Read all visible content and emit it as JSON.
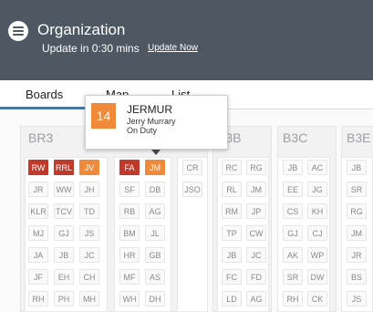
{
  "header": {
    "title": "Organization",
    "update_text": "Update in 0:30 mins",
    "update_link": "Update Now"
  },
  "tabs": [
    {
      "label": "Boards"
    },
    {
      "label": "Map"
    },
    {
      "label": "List"
    }
  ],
  "boards": [
    {
      "name": "BR3"
    },
    {
      "name": "B3B"
    },
    {
      "name": "B3C"
    },
    {
      "name": "B3E"
    }
  ],
  "columns": [
    {
      "cells": [
        [
          "RW",
          "RRL",
          "JV"
        ],
        [
          "JR",
          "WW",
          "JH"
        ],
        [
          "KLR",
          "TCV",
          "TD"
        ],
        [
          "MJ",
          "GJ",
          "JS"
        ],
        [
          "JA",
          "JB",
          "JC"
        ],
        [
          "JF",
          "EH",
          "CH"
        ],
        [
          "RH",
          "PH",
          "MH"
        ]
      ]
    },
    {
      "cells": [
        [
          "FA",
          "JM"
        ],
        [
          "SF",
          "DB"
        ],
        [
          "RB",
          "AG"
        ],
        [
          "BM",
          "JL"
        ],
        [
          "HR",
          "GB"
        ],
        [
          "MF",
          "AS"
        ],
        [
          "WH",
          "DH"
        ]
      ]
    },
    {
      "cells": [
        [
          "CR"
        ],
        [
          "JSO"
        ]
      ]
    },
    {
      "cells": [
        [
          "RC",
          "RG"
        ],
        [
          "RL",
          "JM"
        ],
        [
          "RM",
          "JP"
        ],
        [
          "TP",
          "CW"
        ],
        [
          "JB",
          "JC"
        ],
        [
          "FC",
          "FD"
        ],
        [
          "LD",
          "AG"
        ]
      ]
    },
    {
      "cells": [
        [
          "JB",
          "AC"
        ],
        [
          "EE",
          "JG"
        ],
        [
          "CS",
          "KH"
        ],
        [
          "GJ",
          "CJ"
        ],
        [
          "AK",
          "WP"
        ],
        [
          "SR",
          "DW"
        ],
        [
          "RH",
          "CK"
        ]
      ]
    },
    {
      "cells": [
        [
          "JB"
        ],
        [
          "SR"
        ],
        [
          "RG"
        ],
        [
          "JM"
        ],
        [
          "JR"
        ],
        [
          "BS"
        ],
        [
          "JS"
        ]
      ]
    }
  ],
  "highlight_colors": {
    "red": "#c0392b",
    "orange": "#f08a3a"
  },
  "tooltip": {
    "badge": "14",
    "code": "JERMUR",
    "name": "Jerry Murrary",
    "status": "On Duty"
  },
  "icons": {
    "menu": "hamburger-menu-icon"
  }
}
